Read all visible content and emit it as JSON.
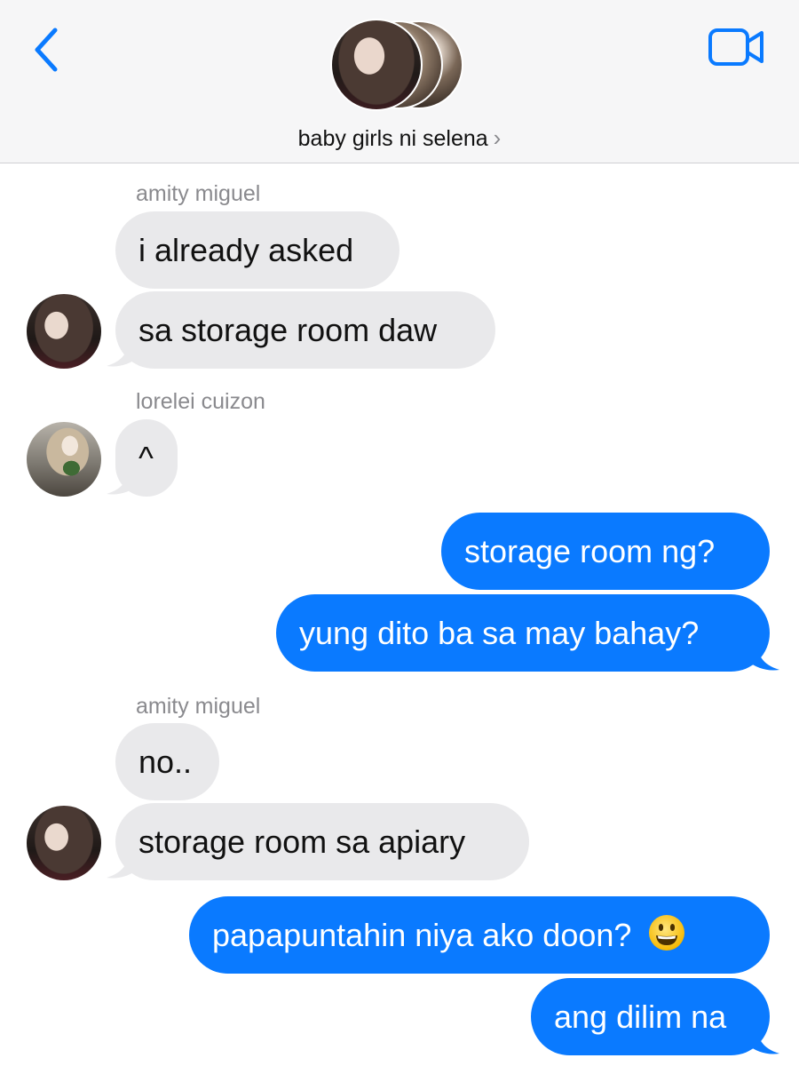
{
  "header": {
    "group_name": "baby girls ni selena",
    "chevron": "›",
    "back_icon": "chevron-left-icon",
    "video_icon": "video-camera-icon",
    "accent_color": "#0a7aff",
    "background_color": "#f6f6f7"
  },
  "messages": [
    {
      "sender": "amity miguel",
      "direction": "incoming",
      "text": "i already asked"
    },
    {
      "sender": "amity miguel",
      "direction": "incoming",
      "text": "sa storage room daw"
    },
    {
      "sender": "lorelei cuizon",
      "direction": "incoming",
      "text": "^"
    },
    {
      "sender": "me",
      "direction": "outgoing",
      "text": "storage room ng?"
    },
    {
      "sender": "me",
      "direction": "outgoing",
      "text": "yung dito ba sa may bahay?"
    },
    {
      "sender": "amity miguel",
      "direction": "incoming",
      "text": "no.."
    },
    {
      "sender": "amity miguel",
      "direction": "incoming",
      "text": "storage room sa apiary"
    },
    {
      "sender": "me",
      "direction": "outgoing",
      "text": "papapuntahin niya ako doon?",
      "emoji": "grinning-face-emoji"
    },
    {
      "sender": "me",
      "direction": "outgoing",
      "text": "ang dilim na"
    }
  ],
  "colors": {
    "incoming_bubble": "#e9e9eb",
    "outgoing_bubble": "#0a7aff",
    "sender_name": "#8a8a8e"
  }
}
